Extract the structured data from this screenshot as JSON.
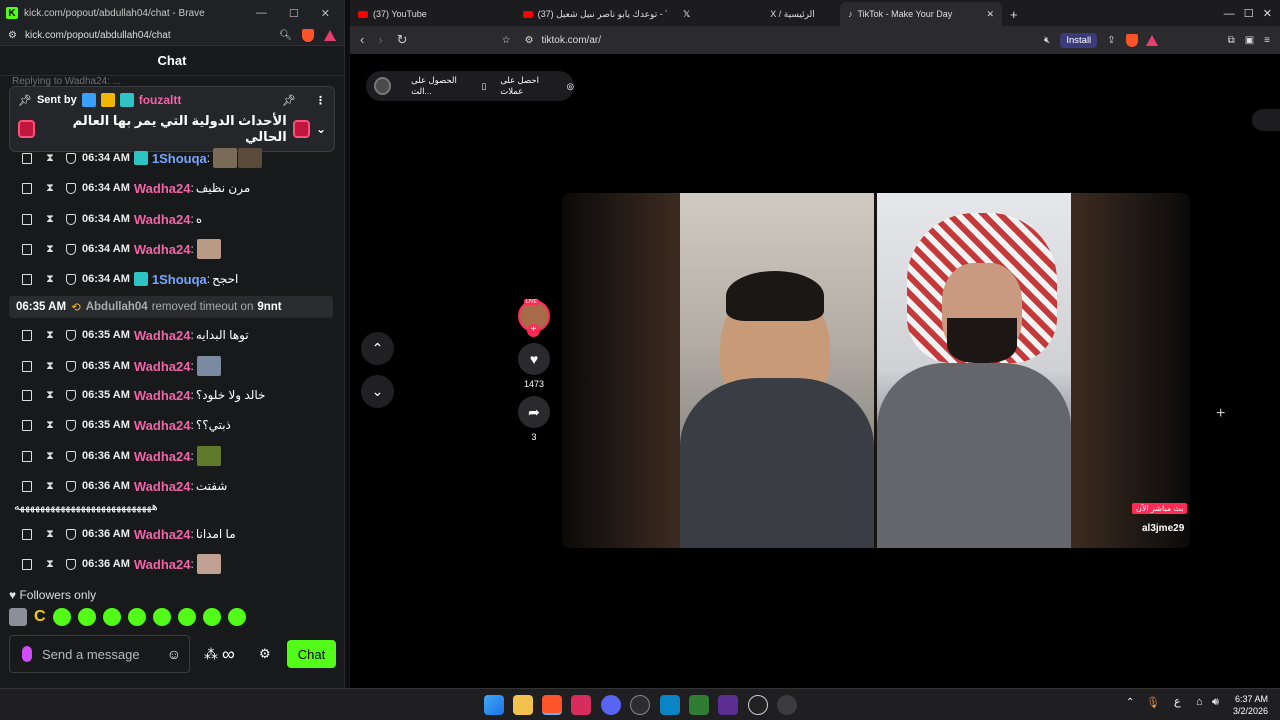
{
  "kick": {
    "window_title": "kick.com/popout/abdullah04/chat - Brave",
    "url": "kick.com/popout/abdullah04/chat",
    "chat_header": "Chat",
    "faded_reply": "Replying to Wadha24: ...",
    "pinned": {
      "sent_by": "Sent by",
      "username": "fouzaltt",
      "message": "الأحداث الدولية التي يمر بها العالم الحالي"
    },
    "messages": [
      {
        "time": "06:34 AM",
        "user": "1Shouqa",
        "text": "",
        "user_color": "#74a8ff"
      },
      {
        "time": "06:34 AM",
        "user": "Wadha24",
        "text": "مرن نظيف",
        "user_color": "#f064a8"
      },
      {
        "time": "06:34 AM",
        "user": "Wadha24",
        "text": "ه",
        "user_color": "#f064a8"
      },
      {
        "time": "06:34 AM",
        "user": "Wadha24",
        "text": "",
        "user_color": "#f064a8"
      },
      {
        "time": "06:34 AM",
        "user": "1Shouqa",
        "text": "احجح",
        "user_color": "#74a8ff"
      },
      {
        "time": "06:35 AM",
        "user": "Wadha24",
        "text": "توها البدايه",
        "user_color": "#f064a8"
      },
      {
        "time": "06:35 AM",
        "user": "Wadha24",
        "text": "",
        "user_color": "#f064a8"
      },
      {
        "time": "06:35 AM",
        "user": "Wadha24",
        "text": "خالد ولا خلود؟",
        "user_color": "#f064a8"
      },
      {
        "time": "06:35 AM",
        "user": "Wadha24",
        "text": "ذبتي؟؟",
        "user_color": "#f064a8"
      },
      {
        "time": "06:36 AM",
        "user": "Wadha24",
        "text": "",
        "user_color": "#f064a8"
      },
      {
        "time": "06:36 AM",
        "user": "Wadha24",
        "text": "شفتت",
        "user_color": "#f064a8"
      },
      {
        "time": "06:36 AM",
        "user": "Wadha24",
        "text": "ما امدانا",
        "user_color": "#f064a8"
      },
      {
        "time": "06:36 AM",
        "user": "Wadha24",
        "text": "",
        "user_color": "#f064a8"
      }
    ],
    "overflow_line": "هههههههههههههههههههههههههههه",
    "system": {
      "time": "06:35 AM",
      "actor": "Abdullah04",
      "action": "removed timeout on",
      "target": "9nnt"
    },
    "followers_only": "Followers only",
    "input_placeholder": "Send a message",
    "chat_button": "Chat"
  },
  "brave": {
    "tabs": [
      {
        "label": "(37) YouTube"
      },
      {
        "label": "(37) توعدك يابو ناصر نبيل شعيل - Tube"
      },
      {
        "label": "X / الرئيسية"
      },
      {
        "label": "TikTok - Make Your Day"
      }
    ],
    "url": "tiktok.com/ar/",
    "install": "Install"
  },
  "tiktok": {
    "get_coins": "احصل على عملات",
    "get_app": "الحصول على الت...",
    "live_badge": "LIVE",
    "likes": "1473",
    "shares": "3",
    "live_now": "بث مباشر الآن",
    "host": "al3jme29"
  },
  "taskbar": {
    "time": "6:37 AM",
    "date": "3/2/2026",
    "lang": "ع"
  },
  "colors": {
    "kick_green": "#53fc18",
    "user_pink": "#f064a8",
    "user_blue": "#74a8ff"
  }
}
